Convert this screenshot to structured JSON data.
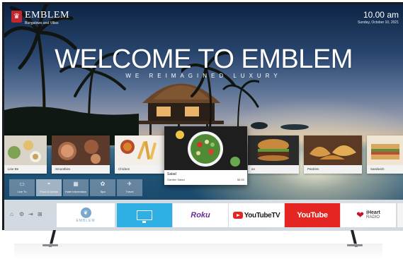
{
  "brand": {
    "logo_glyph": "♛",
    "name": "EMBLEM",
    "subtitle": "Bungalows and Villas"
  },
  "clock": {
    "time": "10.00 am",
    "date": "Sunday, October 10, 2021"
  },
  "hero": {
    "title": "WELCOME TO EMBLEM",
    "tagline": "WE REIMAGINED LUXURY"
  },
  "menu": {
    "items": [
      {
        "label": "Line Be"
      },
      {
        "label": "Smoothies"
      },
      {
        "label": "Chicken"
      },
      {
        "label": "an"
      },
      {
        "label": "Pastries"
      },
      {
        "label": "Sandwich"
      }
    ],
    "featured": {
      "title": "Salad",
      "description": "Garden Salad",
      "price": "$4.50"
    }
  },
  "categories": [
    {
      "label": "Live Tv",
      "icon": "tv-icon",
      "glyph": "▭"
    },
    {
      "label": "Food & Drinks",
      "icon": "cloche-icon",
      "glyph": "◓"
    },
    {
      "label": "Hotel information",
      "icon": "building-icon",
      "glyph": "▦"
    },
    {
      "label": "Spa",
      "icon": "spa-icon",
      "glyph": "✿"
    },
    {
      "label": "Travel",
      "icon": "plane-icon",
      "glyph": "✈"
    }
  ],
  "system_icons": [
    {
      "name": "home-icon",
      "glyph": "⌂"
    },
    {
      "name": "settings-icon",
      "glyph": "⚙"
    },
    {
      "name": "input-source-icon",
      "glyph": "⇥"
    },
    {
      "name": "apps-grid-icon",
      "glyph": "⊞"
    }
  ],
  "apps": {
    "emblem": {
      "glyph": "❦",
      "label": "EMBLEM"
    },
    "roku": "Roku",
    "youtubetv": "YouTubeTV",
    "youtube": "YouTube",
    "iheart_top": "iHeart",
    "iheart_bottom": "RADIO"
  },
  "colors": {
    "brand_red": "#c4262e",
    "tv_blue": "#2fb0e4",
    "youtube_red": "#e52521",
    "roku_purple": "#6a2c91",
    "emblem_blue": "#79a8cc"
  }
}
